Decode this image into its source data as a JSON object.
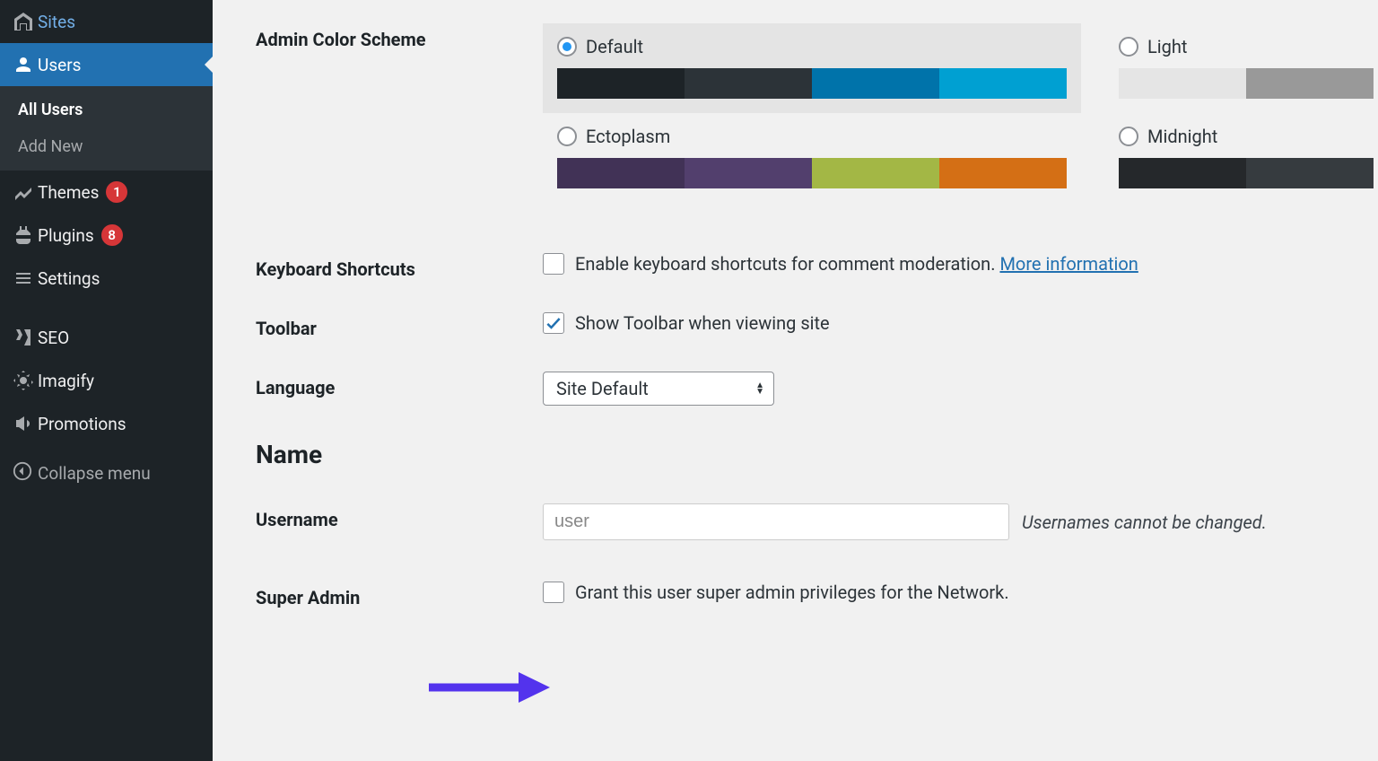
{
  "sidebar": {
    "items": [
      {
        "label": "Sites"
      },
      {
        "label": "Users",
        "active": true,
        "sub": [
          {
            "label": "All Users",
            "current": true
          },
          {
            "label": "Add New"
          }
        ]
      },
      {
        "label": "Themes",
        "badge": "1"
      },
      {
        "label": "Plugins",
        "badge": "8"
      },
      {
        "label": "Settings"
      },
      {
        "label": "SEO"
      },
      {
        "label": "Imagify"
      },
      {
        "label": "Promotions"
      }
    ],
    "collapse": "Collapse menu"
  },
  "form": {
    "color_scheme": {
      "label": "Admin Color Scheme",
      "options": [
        {
          "label": "Default",
          "selected": true,
          "colors": [
            "#1d2327",
            "#2c3338",
            "#0073aa",
            "#00a0d2"
          ]
        },
        {
          "label": "Light",
          "colors": [
            "#e5e5e5",
            "#999999"
          ]
        },
        {
          "label": "Ectoplasm",
          "colors": [
            "#413256",
            "#523f6d",
            "#a3b745",
            "#d46f15"
          ]
        },
        {
          "label": "Midnight",
          "colors": [
            "#25282b",
            "#363b3f"
          ]
        }
      ]
    },
    "keyboard": {
      "label": "Keyboard Shortcuts",
      "checkbox_label": "Enable keyboard shortcuts for comment moderation.",
      "more": "More information"
    },
    "toolbar": {
      "label": "Toolbar",
      "checkbox_label": "Show Toolbar when viewing site"
    },
    "language": {
      "label": "Language",
      "value": "Site Default"
    },
    "section_name": "Name",
    "username": {
      "label": "Username",
      "value": "user",
      "help": "Usernames cannot be changed."
    },
    "super_admin": {
      "label": "Super Admin",
      "checkbox_label": "Grant this user super admin privileges for the Network."
    }
  }
}
